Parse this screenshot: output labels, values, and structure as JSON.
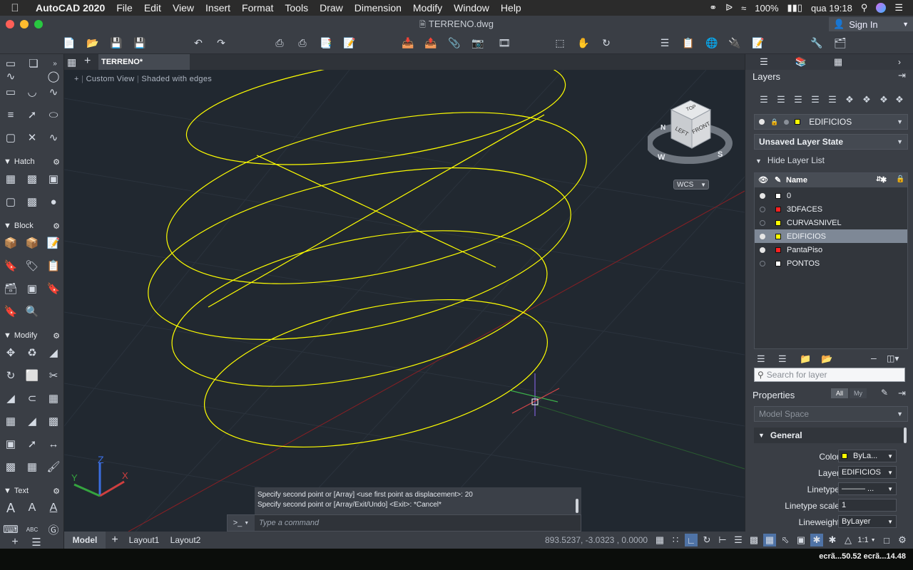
{
  "menubar": {
    "app": "AutoCAD 2020",
    "items": [
      "File",
      "Edit",
      "View",
      "Insert",
      "Format",
      "Tools",
      "Draw",
      "Dimension",
      "Modify",
      "Window",
      "Help"
    ],
    "battery": "100%",
    "clock": "qua 19:18"
  },
  "titlebar": {
    "title": "TERRENO.dwg",
    "sign_in": "Sign In"
  },
  "palette": {
    "sections": {
      "hatch": "Hatch",
      "block": "Block",
      "modify": "Modify",
      "text": "Text"
    }
  },
  "document_tab": {
    "label": "TERRENO*"
  },
  "viewport": {
    "view_label": "Custom View",
    "style_label": "Shaded with edges",
    "viewcube": {
      "top": "TOP",
      "left": "LEFT",
      "front": "FRONT",
      "compass_n": "N",
      "compass_w": "W",
      "compass_s": "S"
    },
    "wcs_label": "WCS",
    "ucs": {
      "x": "X",
      "y": "Y",
      "z": "Z"
    }
  },
  "command": {
    "history": [
      "Specify second point or [Array] <use first point as displacement>: 20",
      "Specify second point or [Array/Exit/Undo] <Exit>: *Cancel*"
    ],
    "prompt_icon": ">_",
    "placeholder": "Type a command"
  },
  "status": {
    "tabs": [
      "Model",
      "Layout1",
      "Layout2"
    ],
    "coords": "893.5237, -3.0323 , 0.0000",
    "scale": "1:1"
  },
  "layers_panel": {
    "title": "Layers",
    "current_layer": "EDIFICIOS",
    "layer_state": "Unsaved Layer State",
    "hide_list": "Hide Layer List",
    "column_name": "Name",
    "layers": [
      {
        "name": "0",
        "color": "#ffffff",
        "on": true,
        "selected": false
      },
      {
        "name": "3DFACES",
        "color": "#ff2020",
        "on": false,
        "selected": false
      },
      {
        "name": "CURVASNIVEL",
        "color": "#ffff00",
        "on": false,
        "selected": false
      },
      {
        "name": "EDIFICIOS",
        "color": "#ffff00",
        "on": true,
        "selected": true
      },
      {
        "name": "PantaPiso",
        "color": "#ff2020",
        "on": true,
        "selected": false
      },
      {
        "name": "PONTOS",
        "color": "#ffffff",
        "on": false,
        "selected": false
      }
    ],
    "search_placeholder": "Search for layer"
  },
  "properties_panel": {
    "title": "Properties",
    "filter_all": "All",
    "filter_my": "My",
    "space": "Model Space",
    "section": "General",
    "rows": [
      {
        "label": "Color",
        "value": "ByLa..."
      },
      {
        "label": "Layer",
        "value": "EDIFICIOS"
      },
      {
        "label": "Linetype",
        "value": "——— ..."
      },
      {
        "label": "Linetype scale",
        "value": "1"
      },
      {
        "label": "Lineweight",
        "value": "ByLayer"
      }
    ]
  },
  "dock": {
    "text": "ecrã...50.52  ecrã...14.48"
  }
}
